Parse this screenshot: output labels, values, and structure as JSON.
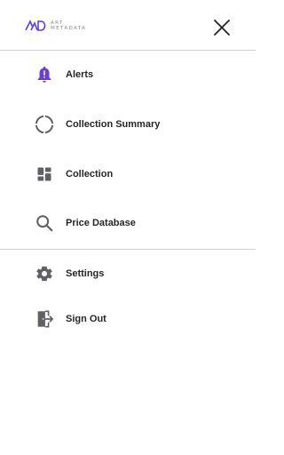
{
  "header": {
    "logo_line1": "ART",
    "logo_line2": "METADATA",
    "logo_color": "#5b3fd1",
    "close_icon": "close-icon"
  },
  "menu": {
    "primary": [
      {
        "label": "Alerts",
        "icon": "bell-icon",
        "color": "#6a3fd6"
      },
      {
        "label": "Collection Summary",
        "icon": "progress-ring-icon",
        "color": "#5f6166"
      },
      {
        "label": "Collection",
        "icon": "dashboard-icon",
        "color": "#5f6166"
      },
      {
        "label": "Price Database",
        "icon": "search-icon",
        "color": "#5f6166"
      }
    ],
    "secondary": [
      {
        "label": "Settings",
        "icon": "gear-icon",
        "color": "#5f6166"
      },
      {
        "label": "Sign Out",
        "icon": "sign-out-icon",
        "color": "#5f6166"
      }
    ]
  }
}
